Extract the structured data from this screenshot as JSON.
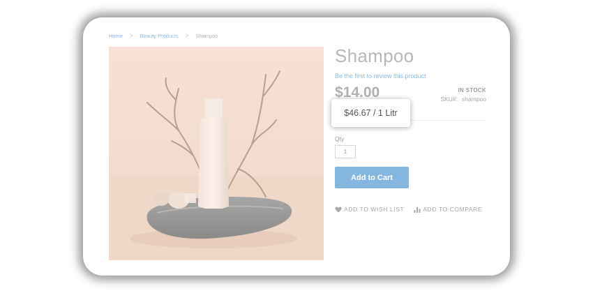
{
  "breadcrumb": {
    "items": [
      "Home",
      "Beauty Products",
      "Shampoo"
    ],
    "separator": ">"
  },
  "product": {
    "name": "Shampoo",
    "review_link": "Be the first to review this product",
    "price": "$14.00",
    "stock_status": "IN STOCK",
    "sku_label": "SKU#:",
    "sku_value": "shampoo",
    "unit_price_tooltip": "$46.67 / 1 Litr",
    "qty_label": "Qty",
    "qty_value": "1",
    "add_to_cart_label": "Add to Cart",
    "wishlist_label": "ADD TO WISH LIST",
    "compare_label": "ADD TO COMPARE"
  },
  "icons": {
    "wishlist": "heart-icon",
    "compare": "bar-chart-icon"
  },
  "colors": {
    "accent": "#85b6e0",
    "link": "#8fbbe0",
    "image_background": "#f6e2d6"
  }
}
